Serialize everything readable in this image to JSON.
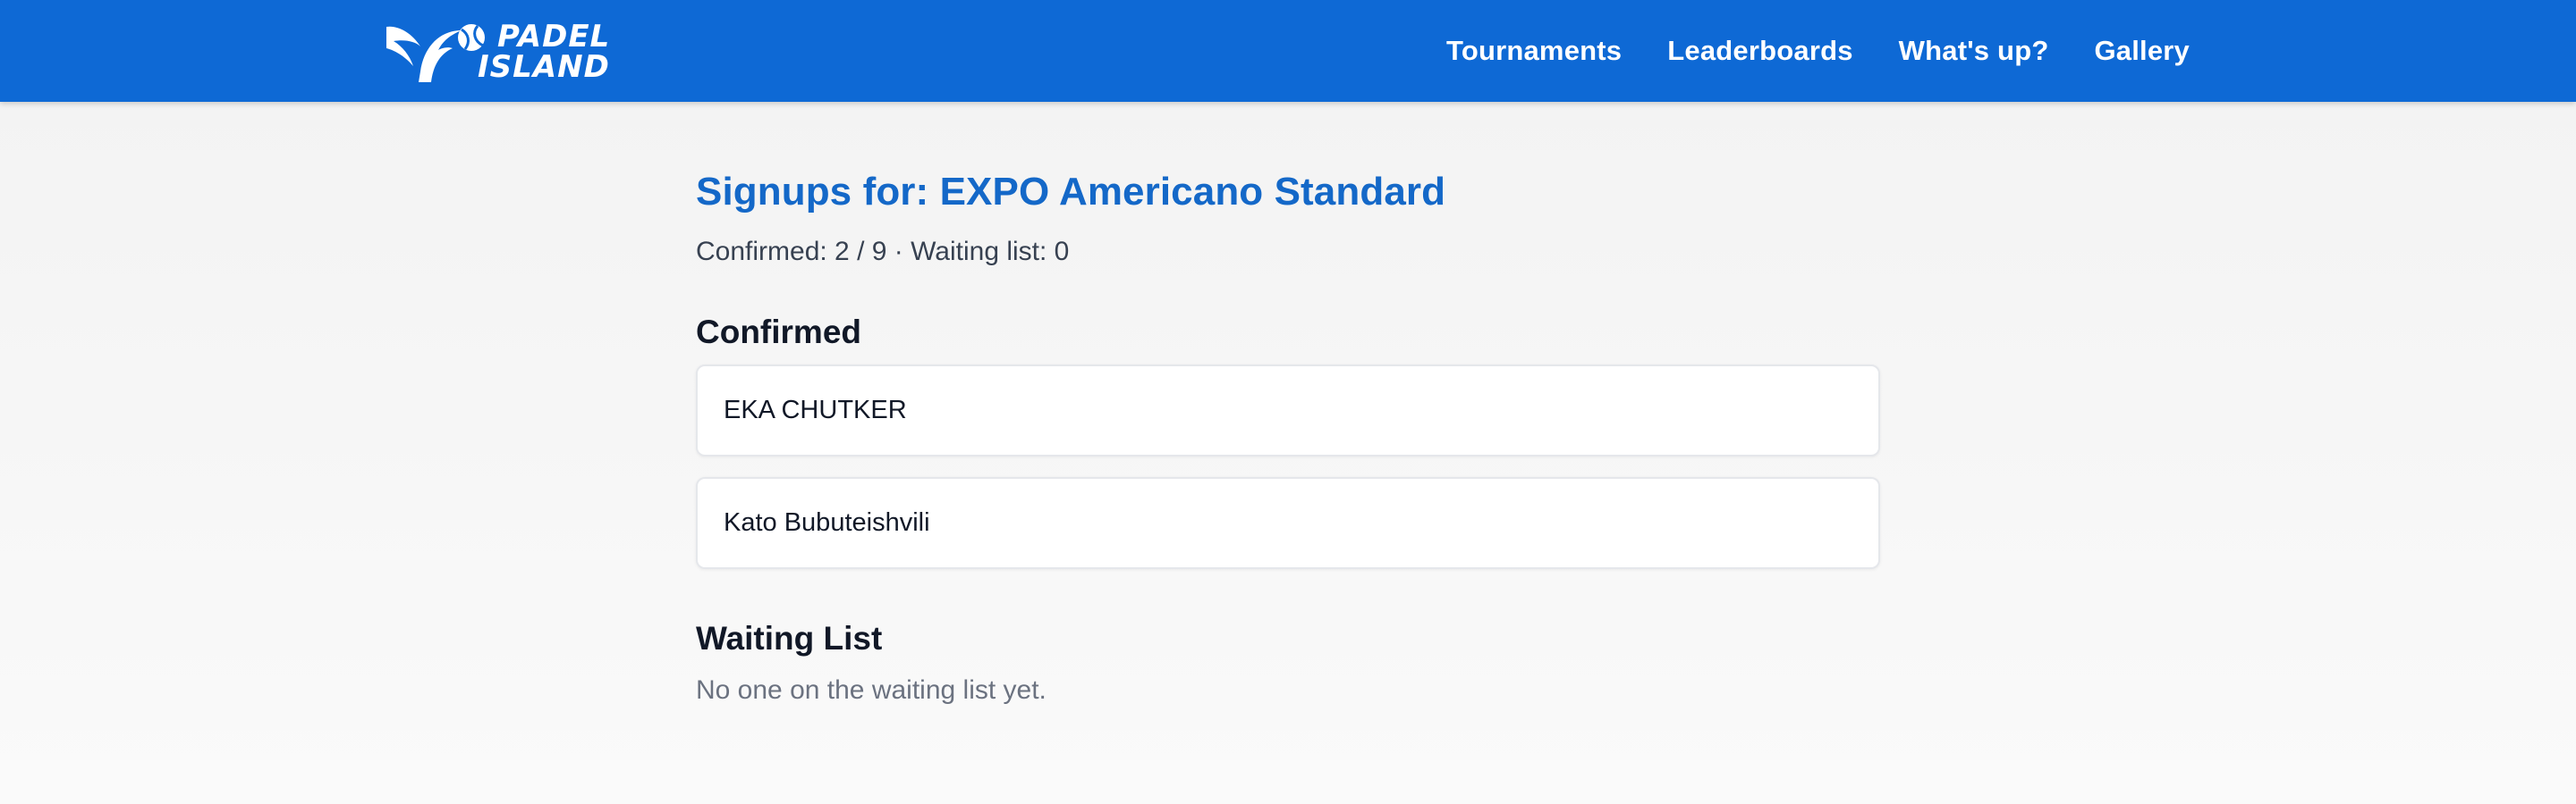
{
  "header": {
    "logo": {
      "line1": "PADEL",
      "line2": "ISLAND",
      "icon": "padel-racket-ball-icon"
    },
    "nav": [
      {
        "label": "Tournaments"
      },
      {
        "label": "Leaderboards"
      },
      {
        "label": "What's up?"
      },
      {
        "label": "Gallery"
      }
    ]
  },
  "main": {
    "title": "Signups for: EXPO Americano Standard",
    "summary": "Confirmed: 2 / 9 · Waiting list: 0",
    "confirmed": {
      "heading": "Confirmed",
      "players": [
        {
          "name": "EKA CHUTKER"
        },
        {
          "name": "Kato Bubuteishvili"
        }
      ]
    },
    "waiting": {
      "heading": "Waiting List",
      "empty_text": "No one on the waiting list yet."
    }
  },
  "colors": {
    "header_bg": "#0e69d5",
    "title": "#1468c8",
    "page_bg": "#f6f6f6"
  }
}
